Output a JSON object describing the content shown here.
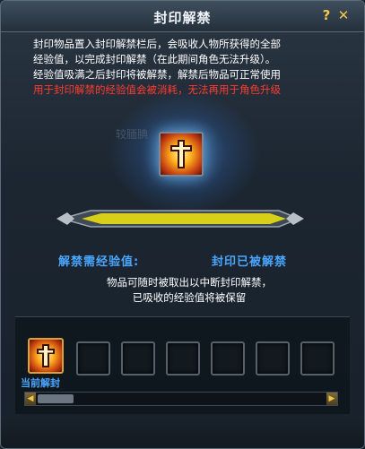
{
  "window": {
    "title": "封印解禁"
  },
  "controls": {
    "help": "?",
    "close": "✕"
  },
  "description": {
    "line1": "封印物品置入封印解禁栏后，会吸收人物所获得的全部",
    "line2": "经验值，以完成封印解禁（在此期间角色无法升级）。",
    "line3": "经验值吸满之后封印将被解禁，解禁后物品可正常使用",
    "warning": "用于封印解禁的经验值会被消耗，无法再用于角色升级"
  },
  "ghost_label": "较腼腆",
  "seal_icon": "sealed-cross-icon",
  "exp_bar": {
    "progress": 1.0,
    "color": "#d8cf18"
  },
  "labels": {
    "required_exp": "解禁需经验值:",
    "status": "封印已被解禁"
  },
  "note": {
    "line1": "物品可随时被取出以中断封印解禁，",
    "line2": "已吸收的经验值将被保留"
  },
  "slots": {
    "current_label": "当前解封",
    "empty_count": 6
  },
  "scrollbar": {
    "left": "◀",
    "right": "▶"
  }
}
